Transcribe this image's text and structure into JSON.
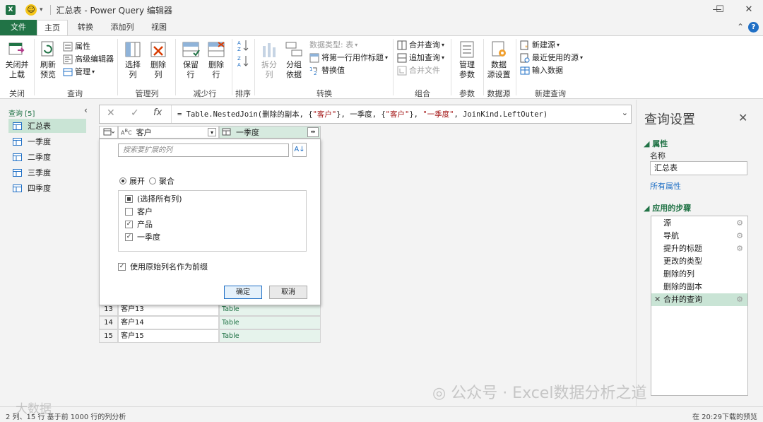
{
  "window": {
    "title": "汇总表 - Power Query 编辑器",
    "controls": [
      "minimize",
      "maximize",
      "close"
    ]
  },
  "tabs": [
    "文件",
    "主页",
    "转换",
    "添加列",
    "视图"
  ],
  "ribbon": {
    "close": {
      "button": "关闭并\n上载",
      "label": "关闭并上载",
      "group": "关闭"
    },
    "query": {
      "refresh": "刷新\n预览",
      "properties": "属性",
      "advanced_editor": "高级编辑器",
      "manage": "管理",
      "group": "查询"
    },
    "manage_columns": {
      "choose": "选择\n列",
      "remove": "删除\n列",
      "group": "管理列"
    },
    "reduce_rows": {
      "keep": "保留\n行",
      "remove": "删除\n行",
      "group": "减少行"
    },
    "sort": {
      "group": "排序"
    },
    "transform": {
      "split": "拆分\n列",
      "group_by": "分组\n依据",
      "data_type": "数据类型: 表",
      "first_row_header": "将第一行用作标题",
      "replace": "替换值",
      "group": "转换"
    },
    "combine": {
      "merge": "合并查询",
      "append": "追加查询",
      "merge_files": "合并文件",
      "group": "组合"
    },
    "parameters": {
      "manage": "管理\n参数",
      "group": "参数"
    },
    "data_source": {
      "settings": "数据\n源设置",
      "group": "数据源"
    },
    "new_query": {
      "new_source": "新建源",
      "recent": "最近使用的源",
      "enter_data": "输入数据",
      "group": "新建查询"
    }
  },
  "left_nav": {
    "header": "查询 [5]",
    "queries": [
      "汇总表",
      "一季度",
      "二季度",
      "三季度",
      "四季度"
    ],
    "selected": "汇总表"
  },
  "formula_bar": {
    "prefix": "= Table.NestedJoin(删除的副本, {",
    "s1": "\"客户\"",
    "mid1": "}, 一季度, {",
    "s2": "\"客户\"",
    "mid2": "}, ",
    "s3": "\"一季度\"",
    "suffix": ", JoinKind.LeftOuter)"
  },
  "grid": {
    "columns": [
      "客户",
      "一季度"
    ],
    "rows": [
      {
        "n": "13",
        "customer": "客户13",
        "value": "Table"
      },
      {
        "n": "14",
        "customer": "客户14",
        "value": "Table"
      },
      {
        "n": "15",
        "customer": "客户15",
        "value": "Table"
      }
    ]
  },
  "expand_popup": {
    "search_placeholder": "搜索要扩展的列",
    "radio_expand": "展开",
    "radio_aggregate": "聚合",
    "selected_mode": "展开",
    "columns": [
      {
        "label": "(选择所有列)",
        "state": "partial"
      },
      {
        "label": "客户",
        "state": "unchecked"
      },
      {
        "label": "产品",
        "state": "checked"
      },
      {
        "label": "一季度",
        "state": "checked"
      }
    ],
    "prefix_label": "使用原始列名作为前缀",
    "prefix_checked": true,
    "ok": "确定",
    "cancel": "取消"
  },
  "settings": {
    "title": "查询设置",
    "properties": "属性",
    "name_label": "名称",
    "name_value": "汇总表",
    "all_properties": "所有属性",
    "applied_steps": "应用的步骤",
    "steps": [
      {
        "label": "源",
        "gear": true
      },
      {
        "label": "导航",
        "gear": true
      },
      {
        "label": "提升的标题",
        "gear": true
      },
      {
        "label": "更改的类型",
        "gear": false
      },
      {
        "label": "删除的列",
        "gear": false
      },
      {
        "label": "删除的副本",
        "gear": false
      },
      {
        "label": "合并的查询",
        "gear": true,
        "selected": true
      }
    ]
  },
  "status": {
    "left": "2 列、15 行    基于前 1000 行的列分析",
    "right": "在 20:29下载的预览"
  },
  "watermark": {
    "right": "公众号 · Excel数据分析之道",
    "left": "大数据"
  },
  "colors": {
    "accent": "#217346",
    "link": "#1f6fc5",
    "selected": "#c9e4d5"
  }
}
